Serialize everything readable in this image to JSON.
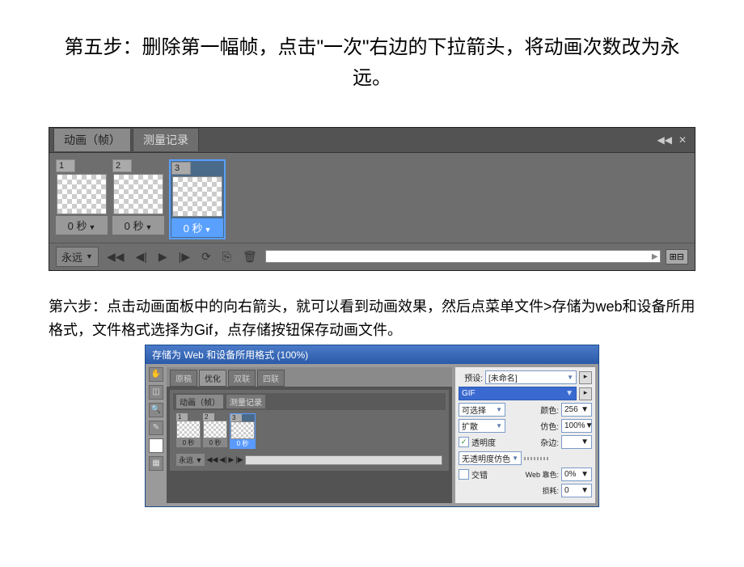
{
  "title": "第五步：删除第一幅帧，点击\"一次\"右边的下拉箭头，将动画次数改为永远。",
  "panel1": {
    "tabs": {
      "anim": "动画（帧）",
      "measure": "测量记录"
    },
    "frames": [
      {
        "num": "1",
        "time": "0 秒"
      },
      {
        "num": "2",
        "time": "0 秒"
      },
      {
        "num": "3",
        "time": "0 秒"
      }
    ],
    "loop": "永远"
  },
  "step6": "第六步：点击动画面板中的向右箭头，就可以看到动画效果，然后点菜单文件>存储为web和设备所用格式，文件格式选择为Gif，点存储按钮保存动画文件。",
  "dialog": {
    "title": "存储为 Web 和设备所用格式 (100%)",
    "tabs": {
      "original": "原稿",
      "optimize": "优化",
      "two": "双联",
      "four": "四联"
    },
    "anim_tab1": "动画（帧）",
    "anim_tab2": "测量记录",
    "frames": [
      {
        "num": "1",
        "time": "0 秒"
      },
      {
        "num": "2",
        "time": "0 秒"
      },
      {
        "num": "3",
        "time": "0 秒"
      }
    ],
    "loop": "永远",
    "settings": {
      "preset_label": "预设:",
      "preset_value": "[未命名]",
      "gif": "GIF",
      "reduction": "可选择",
      "colors_label": "颜色:",
      "colors_value": "256",
      "dither": "扩散",
      "dither_label": "仿色:",
      "dither_value": "100%",
      "transparency": "透明度",
      "matte_label": "杂边:",
      "no_trans_dither": "无透明度仿色",
      "interlaced": "交错",
      "web_snap_label": "Web 靠色:",
      "web_snap_value": "0%",
      "lossy_label": "损耗:",
      "lossy_value": "0"
    }
  }
}
